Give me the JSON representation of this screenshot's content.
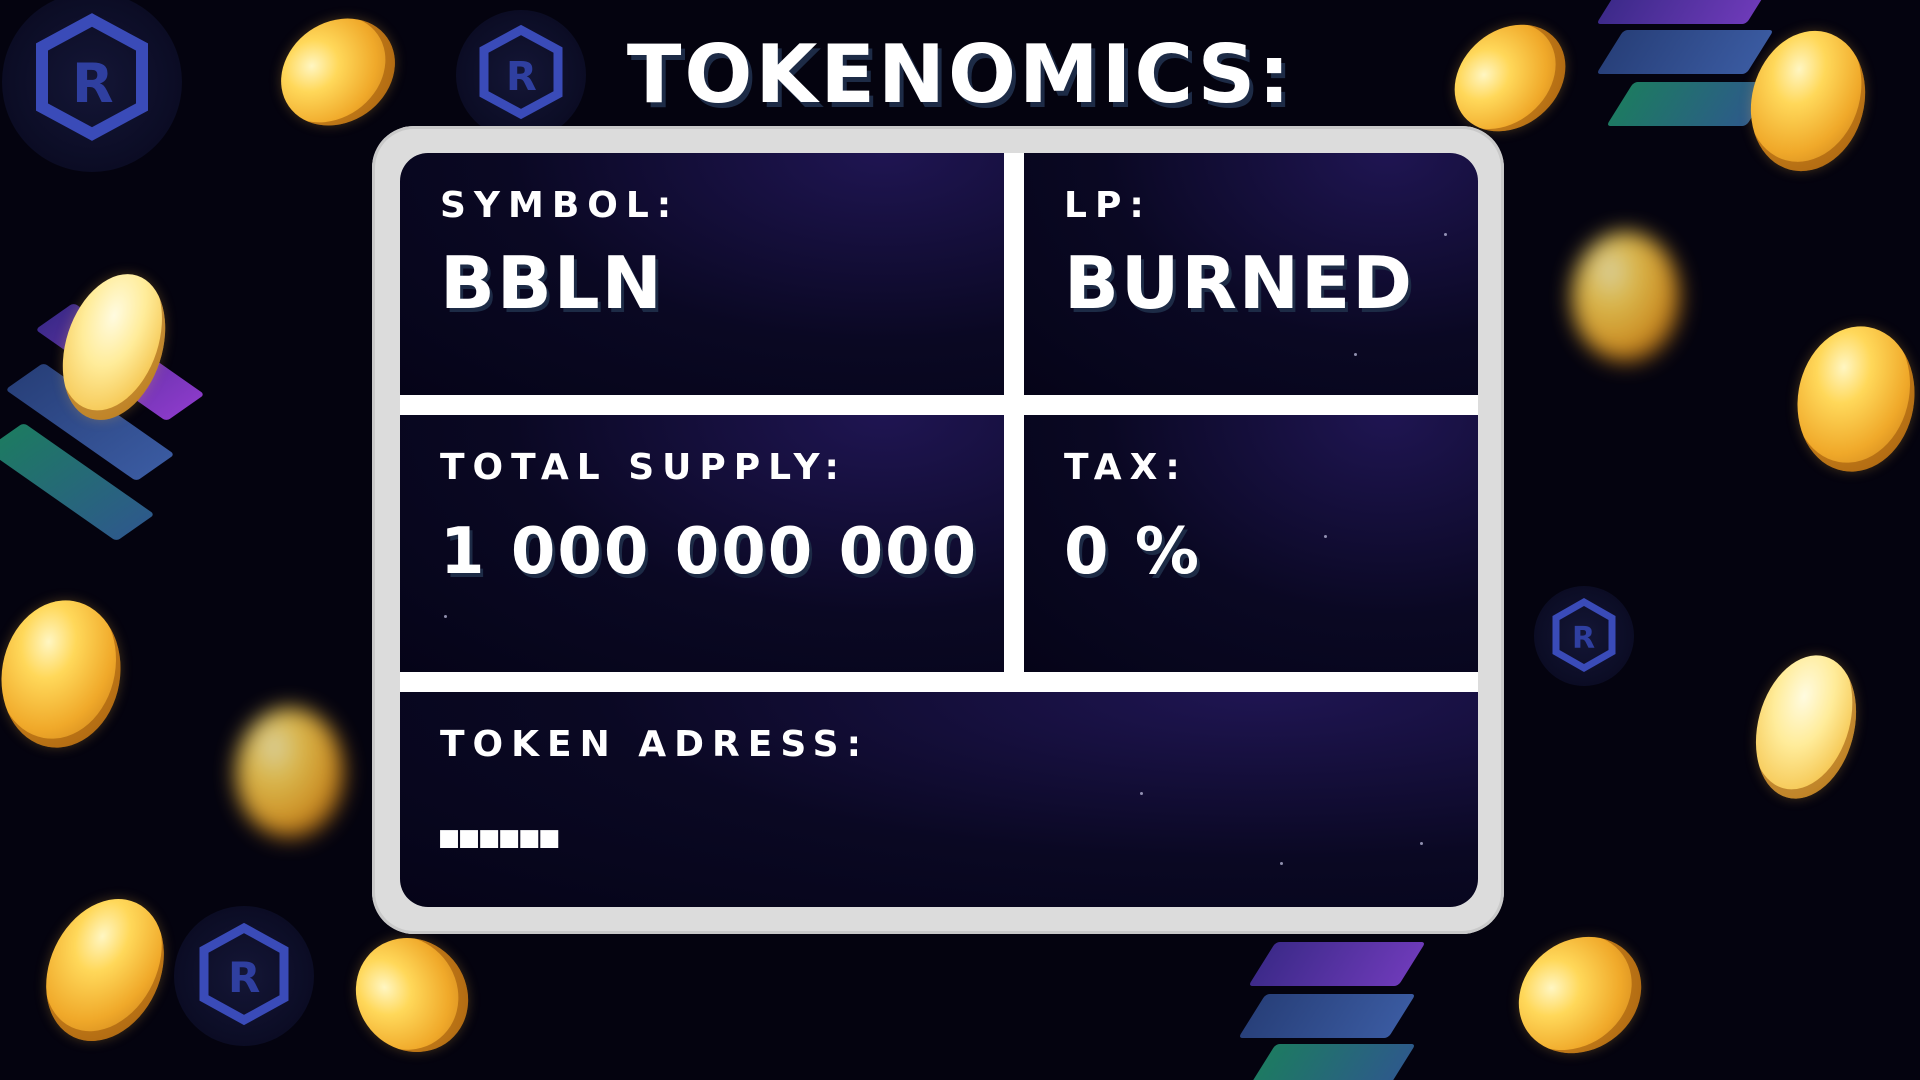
{
  "title": "TOKENOMICS:",
  "cells": {
    "symbol": {
      "label": "SYMBOL:",
      "value": "BBLN"
    },
    "lp": {
      "label": "LP:",
      "value": "BURNED"
    },
    "total_supply": {
      "label": "TOTAL SUPPLY:",
      "value": "1 000 000 000"
    },
    "tax": {
      "label": "TAX:",
      "value": "0 %"
    },
    "token_address": {
      "label": "TOKEN ADRESS:",
      "value": "■■■■■■"
    }
  },
  "icons": {
    "coin": "gold-coin-icon",
    "logo": "hexagon-r-logo-icon",
    "stripes": "solana-stripes-icon"
  },
  "colors": {
    "background": "#04030f",
    "frame": "#dcdcdc",
    "cell_background": "#0a0823",
    "text": "#ffffff",
    "coin": "#f0a92a"
  }
}
